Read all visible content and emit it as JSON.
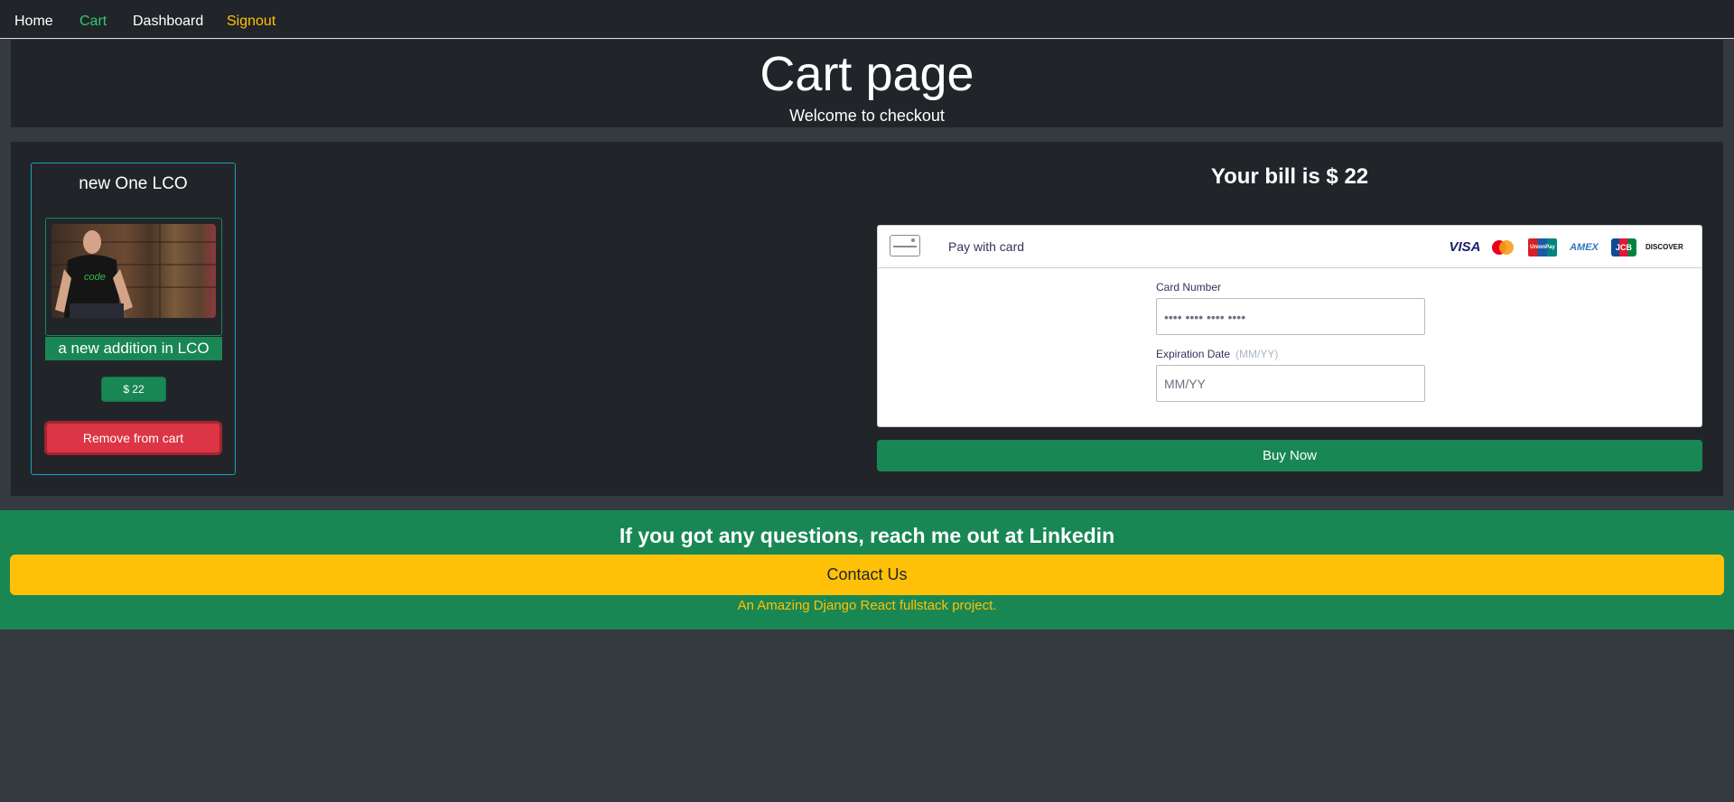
{
  "nav": {
    "items": [
      {
        "label": "Home",
        "color": "#ffffff"
      },
      {
        "label": "Cart",
        "color": "#2ecc71"
      },
      {
        "label": "Dashboard",
        "color": "#ffffff"
      },
      {
        "label": "Signout",
        "color": "#ffc107"
      }
    ]
  },
  "header": {
    "title": "Cart page",
    "subtitle": "Welcome to checkout"
  },
  "product": {
    "title": "new One LCO",
    "image_icon": "tshirt-product-photo",
    "description": "a new addition in LCO",
    "price": "$ 22",
    "remove_label": "Remove from cart"
  },
  "checkout": {
    "bill": "Your bill is $ 22",
    "pay_label": "Pay with card",
    "brands": [
      "VISA",
      "mastercard",
      "UnionPay",
      "AMEX",
      "JCB",
      "DISCOVER"
    ],
    "card_number_label": "Card Number",
    "card_number_placeholder": "•••• •••• •••• ••••",
    "expiry_label": "Expiration Date",
    "expiry_hint": "(MM/YY)",
    "expiry_placeholder": "MM/YY",
    "buy_label": "Buy Now"
  },
  "footer": {
    "title": "If you got any questions, reach me out at Linkedin",
    "contact_label": "Contact Us",
    "note": "An Amazing Django React fullstack project."
  },
  "colors": {
    "success": "#198754",
    "danger": "#dc3545",
    "warning": "#ffc107",
    "info": "#17a2b8",
    "dark": "#212529",
    "background": "#343a40"
  }
}
